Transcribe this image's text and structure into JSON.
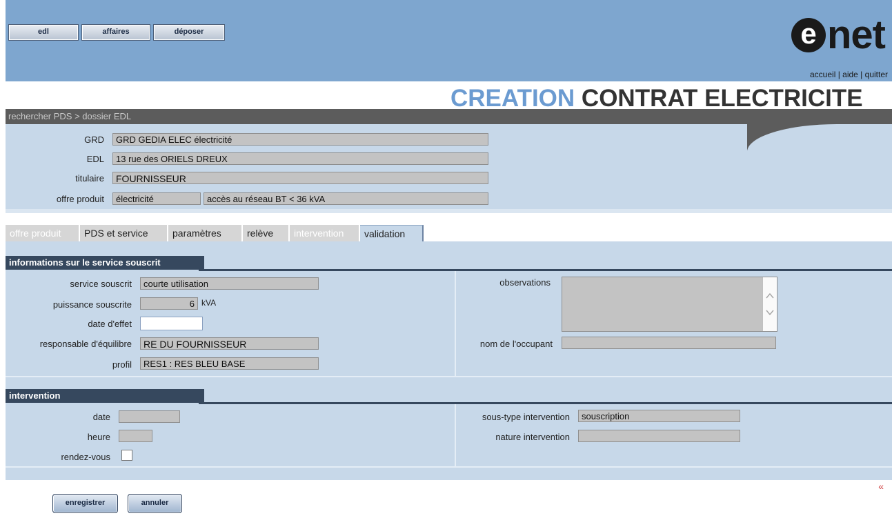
{
  "nav": {
    "btn1": "edl",
    "btn2": "affaires",
    "btn3": "déposer"
  },
  "logo": {
    "e": "e",
    "net": "net"
  },
  "links": {
    "accueil": "accueil",
    "sep": " | ",
    "aide": "aide",
    "quitter": "quitter"
  },
  "title": {
    "part1": "CREATION",
    "part2": " CONTRAT ELECTRICITE"
  },
  "breadcrumb": "rechercher PDS > dossier EDL",
  "summary": {
    "grd_label": "GRD",
    "grd_value": "GRD GEDIA ELEC électricité",
    "edl_label": "EDL",
    "edl_value": "13 rue des ORIELS DREUX",
    "titulaire_label": "titulaire",
    "titulaire_value": " FOURNISSEUR",
    "offre_label": "offre produit",
    "offre_value1": "électricité",
    "offre_value2": "accès au réseau BT < 36 kVA"
  },
  "tabs": [
    "offre produit",
    "PDS et service",
    "paramètres",
    "relève",
    "intervention",
    "validation"
  ],
  "service": {
    "header": "informations sur le service souscrit",
    "service_label": "service souscrit",
    "service_value": "courte utilisation",
    "puissance_label": "puissance souscrite",
    "puissance_value": "6",
    "puissance_unit": "kVA",
    "date_label": "date d'effet",
    "date_value": "",
    "resp_label": "responsable d'équilibre",
    "resp_value": "RE DU FOURNISSEUR",
    "profil_label": "profil",
    "profil_value": "RES1 : RES BLEU BASE",
    "obs_label": "observations",
    "occupant_label": "nom de l'occupant",
    "occupant_value": ""
  },
  "intervention": {
    "header": "intervention",
    "date_label": "date",
    "date_value": "",
    "heure_label": "heure",
    "heure_value": "",
    "rdv_label": "rendez-vous",
    "soustype_label": "sous-type intervention",
    "soustype_value": "souscription",
    "nature_label": "nature intervention",
    "nature_value": ""
  },
  "footer": {
    "save": "enregistrer",
    "cancel": "annuler",
    "collapse": "«"
  },
  "colors": {
    "header_blue": "#7ea6cf",
    "panel_blue": "#c7d8e9",
    "section_dark": "#36485e",
    "title_blue": "#6b9bd1"
  }
}
